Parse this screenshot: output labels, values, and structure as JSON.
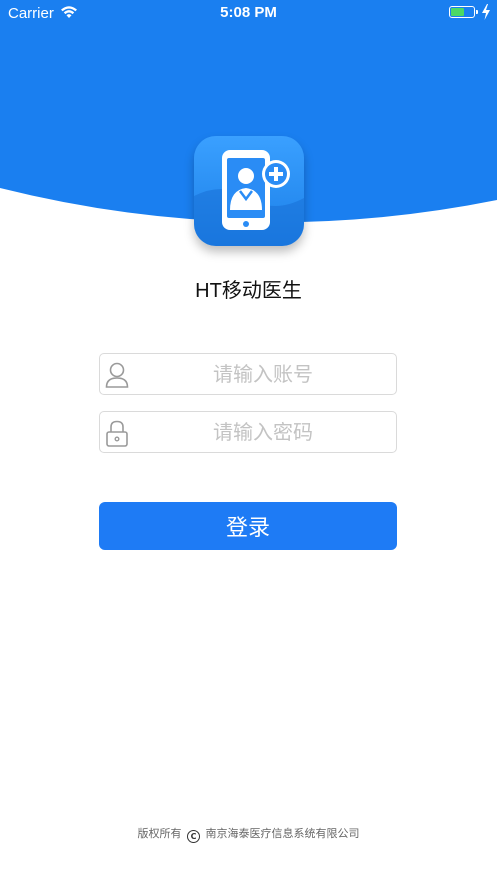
{
  "status_bar": {
    "carrier": "Carrier",
    "time": "5:08 PM",
    "battery_level": 0.56
  },
  "theme": {
    "primary": "#1e7bf5",
    "header_blue": "#1a7ff0",
    "battery_green": "#4cd964"
  },
  "app": {
    "name": "HT移动医生",
    "logo_icon": "doctor-phone-plus-icon"
  },
  "form": {
    "username_placeholder": "请输入账号",
    "username_value": "",
    "username_icon": "user-icon",
    "password_placeholder": "请输入密码",
    "password_value": "",
    "password_icon": "lock-icon",
    "login_label": "登录"
  },
  "footer": {
    "prefix": "版权所有",
    "symbol": "C",
    "company": "南京海泰医疗信息系统有限公司"
  }
}
